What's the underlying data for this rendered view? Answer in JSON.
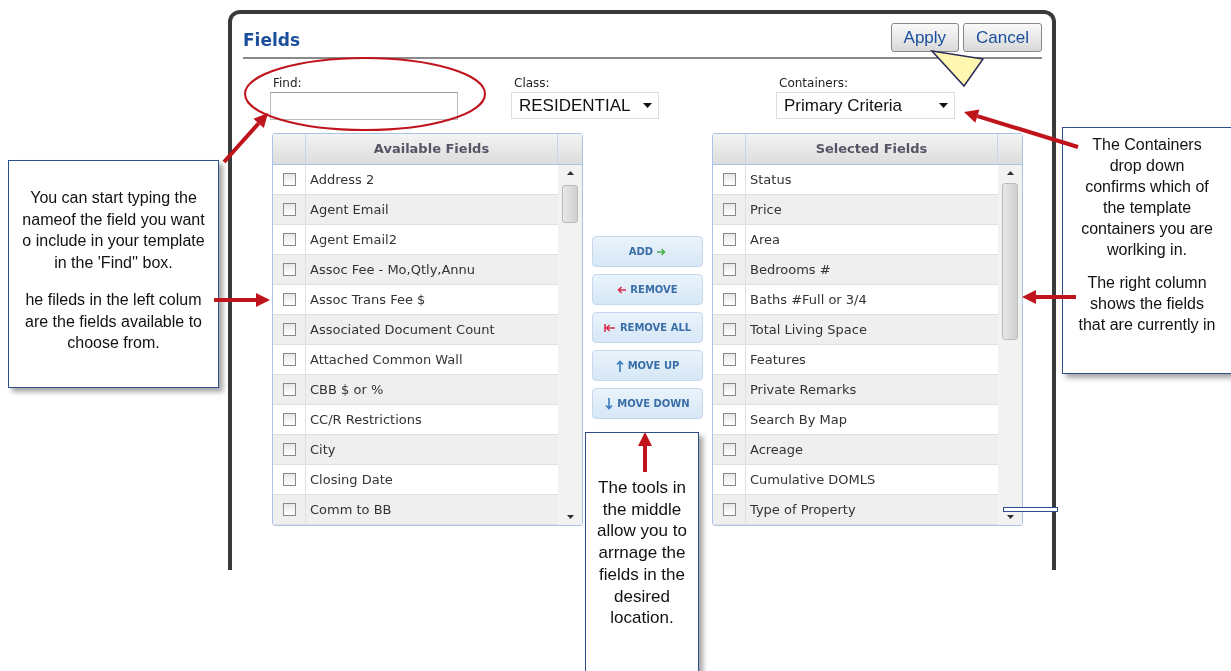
{
  "dialog": {
    "title": "Fields",
    "buttons": [
      {
        "label": "Apply"
      },
      {
        "label": "Cancel"
      }
    ],
    "find": {
      "label": "Find:"
    },
    "class": {
      "label": "Class:",
      "value": "RESIDENTIAL"
    },
    "containers": {
      "label": "Containers:",
      "value": "Primary Criteria"
    },
    "available_fields": {
      "title": "Available Fields",
      "rows": [
        {
          "label": "Address 2",
          "checked": false
        },
        {
          "label": "Agent Email",
          "checked": false
        },
        {
          "label": "Agent Email2",
          "checked": false
        },
        {
          "label": "Assoc Fee - Mo,Qtly,Annu",
          "checked": false
        },
        {
          "label": "Assoc Trans Fee $",
          "checked": false
        },
        {
          "label": "Associated Document Count",
          "checked": false
        },
        {
          "label": "Attached Common Wall",
          "checked": false
        },
        {
          "label": "CBB $ or %",
          "checked": false
        },
        {
          "label": "CC/R Restrictions",
          "checked": false
        },
        {
          "label": "City",
          "checked": false
        },
        {
          "label": "Closing Date",
          "checked": false
        },
        {
          "label": "Comm to BB",
          "checked": false
        }
      ]
    },
    "tools": [
      {
        "label": "ADD",
        "kind": "add"
      },
      {
        "label": "REMOVE",
        "kind": "remove"
      },
      {
        "label": "REMOVE ALL",
        "kind": "removeall"
      },
      {
        "label": "MOVE UP",
        "kind": "up"
      },
      {
        "label": "MOVE DOWN",
        "kind": "down"
      }
    ],
    "selected_fields": {
      "title": "Selected Fields",
      "rows": [
        {
          "label": "Status",
          "checked": false
        },
        {
          "label": "Price",
          "checked": false
        },
        {
          "label": "Area",
          "checked": false
        },
        {
          "label": "Bedrooms #",
          "checked": false
        },
        {
          "label": "Baths #Full or 3/4",
          "checked": false
        },
        {
          "label": "Total Living Space",
          "checked": false
        },
        {
          "label": "Features",
          "checked": false
        },
        {
          "label": "Private Remarks",
          "checked": false
        },
        {
          "label": "Search By Map",
          "checked": false
        },
        {
          "label": "Acreage",
          "checked": false
        },
        {
          "label": "Cumulative DOMLS",
          "checked": false
        },
        {
          "label": "Type of Property",
          "checked": false
        }
      ]
    }
  },
  "callouts": [
    {
      "paragraphs": [
        [
          "You can start typing the",
          "nameof the field you want",
          "o include in your template",
          "in the 'Find'' box."
        ],
        [
          "he fileds in the left colum",
          "are the fields available to",
          "choose from."
        ]
      ]
    },
    {
      "paragraphs": [
        [
          "The Containers",
          "drop down",
          "confirms which of",
          "the template",
          "containers you are",
          "worlking in."
        ],
        [
          "The right column",
          "shows the fields",
          "that are currently in"
        ]
      ]
    },
    {
      "paragraphs": [
        [
          "The tools in",
          "the middle",
          "allow you to",
          "arrnage the",
          "fields in the",
          "desired",
          "location."
        ]
      ]
    }
  ]
}
